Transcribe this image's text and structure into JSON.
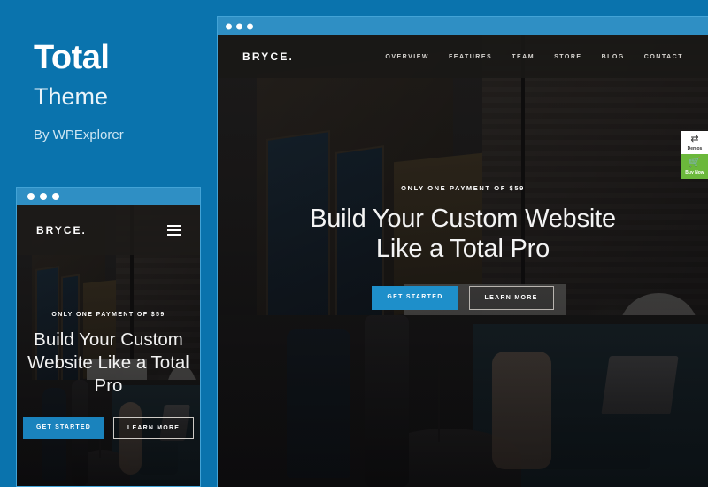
{
  "promo": {
    "title": "Total",
    "subtitle": "Theme",
    "byline": "By WPExplorer"
  },
  "colors": {
    "page_background": "#0a73ad",
    "chrome_bar": "#2f8fc4",
    "accent_button": "#1e8fca",
    "buy_now_green": "#6bb83b"
  },
  "desktop_preview": {
    "window_dots": [
      "dot-red",
      "dot-yellow",
      "dot-green"
    ],
    "site": {
      "brand": "BRYCE.",
      "nav": [
        {
          "label": "OVERVIEW"
        },
        {
          "label": "FEATURES"
        },
        {
          "label": "TEAM"
        },
        {
          "label": "STORE"
        },
        {
          "label": "BLOG"
        },
        {
          "label": "CONTACT"
        }
      ],
      "hero": {
        "eyebrow": "ONLY ONE PAYMENT OF $59",
        "title_line1": "Build Your Custom Website",
        "title_line2": "Like a Total Pro",
        "primary_button": "GET STARTED",
        "secondary_button": "LEARN MORE"
      }
    },
    "side_buttons": [
      {
        "label": "Demos",
        "icon": "demos-swap-icon"
      },
      {
        "label": "Buy Now",
        "icon": "shopping-cart-icon"
      }
    ]
  },
  "mobile_preview": {
    "window_dots": [
      "dot-red",
      "dot-yellow",
      "dot-green"
    ],
    "site": {
      "brand": "BRYCE.",
      "menu_icon": "hamburger-menu-icon",
      "hero": {
        "eyebrow": "ONLY ONE PAYMENT OF $59",
        "title": "Build Your Custom Website Like a Total Pro",
        "primary_button": "GET STARTED",
        "secondary_button": "LEARN MORE"
      }
    }
  }
}
